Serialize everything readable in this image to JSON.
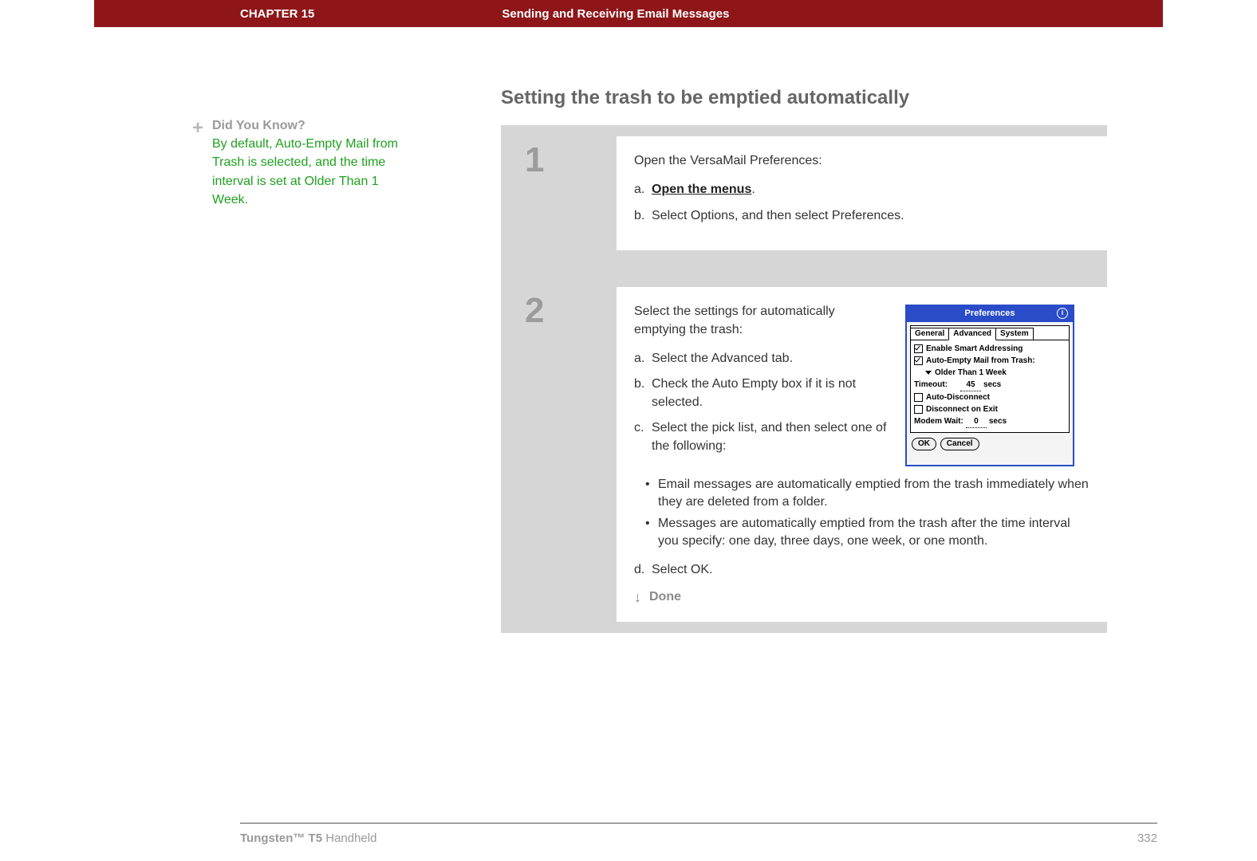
{
  "header": {
    "chapter": "CHAPTER 15",
    "title": "Sending and Receiving Email Messages"
  },
  "sidebar": {
    "tip_heading": "Did You Know?",
    "tip_body": "By default, Auto-Empty Mail from Trash is selected, and the time interval is set at Older Than 1 Week."
  },
  "section_title": "Setting the trash to be emptied automatically",
  "steps": [
    {
      "number": "1",
      "intro": "Open the VersaMail Preferences:",
      "sub": [
        {
          "label": "a.",
          "body_link": "Open the menus",
          "body_after": "."
        },
        {
          "label": "b.",
          "body": "Select Options, and then select Preferences."
        }
      ]
    },
    {
      "number": "2",
      "intro": "Select the settings for automatically emptying the trash:",
      "sub": [
        {
          "label": "a.",
          "body": "Select the Advanced tab."
        },
        {
          "label": "b.",
          "body": "Check the Auto Empty box if it is not selected."
        },
        {
          "label": "c.",
          "body": "Select the pick list, and then select one of the following:"
        }
      ],
      "bullets": [
        "Email messages are automatically emptied from the trash immediately when they are deleted from a folder.",
        "Messages are automatically emptied from the trash after the time interval you specify: one day, three days, one week, or one month."
      ],
      "sub_after": [
        {
          "label": "d.",
          "body": "Select OK."
        }
      ],
      "done_label": "Done"
    }
  ],
  "palm": {
    "title": "Preferences",
    "tabs": {
      "general": "General",
      "advanced": "Advanced",
      "system": "System"
    },
    "opts": {
      "smart_addressing": "Enable Smart Addressing",
      "auto_empty": "Auto-Empty Mail from Trash:",
      "interval": "Older Than 1 Week",
      "timeout_label": "Timeout:",
      "timeout_value": "45",
      "timeout_unit": "secs",
      "auto_disconnect": "Auto-Disconnect",
      "disconnect_on_exit": "Disconnect on Exit",
      "modem_wait_label": "Modem Wait:",
      "modem_wait_value": "0",
      "modem_wait_unit": "secs"
    },
    "buttons": {
      "ok": "OK",
      "cancel": "Cancel"
    }
  },
  "footer": {
    "product_bold": "Tungsten™ T5",
    "product_light": " Handheld",
    "page": "332"
  }
}
